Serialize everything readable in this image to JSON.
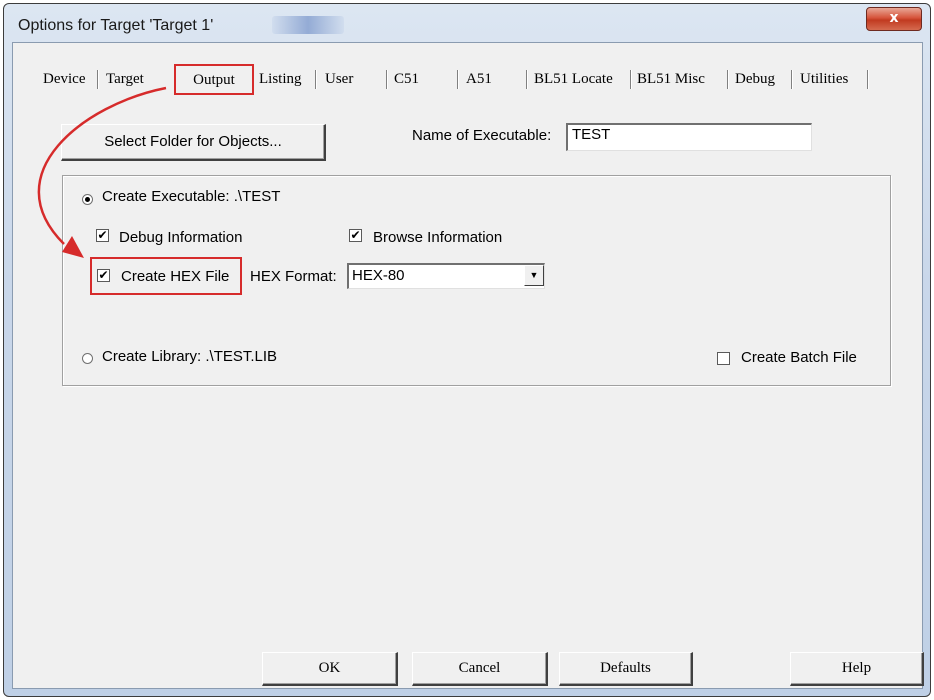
{
  "window": {
    "title": "Options for Target 'Target 1'",
    "close_glyph": "x"
  },
  "tabs": [
    "Device",
    "Target",
    "Output",
    "Listing",
    "User",
    "C51",
    "A51",
    "BL51 Locate",
    "BL51 Misc",
    "Debug",
    "Utilities"
  ],
  "active_tab": "Output",
  "output_page": {
    "select_folder_button": "Select Folder for Objects...",
    "name_of_executable_label": "Name of Executable:",
    "name_of_executable_value": "TEST",
    "create_executable_label": "Create Executable:  .\\TEST",
    "create_executable_selected": true,
    "debug_information_label": "Debug Information",
    "debug_information_checked": true,
    "browse_information_label": "Browse Information",
    "browse_information_checked": true,
    "create_hex_label": "Create HEX File",
    "create_hex_checked": true,
    "hex_format_label": "HEX Format:",
    "hex_format_value": "HEX-80",
    "create_library_label": "Create Library:  .\\TEST.LIB",
    "create_library_selected": false,
    "create_batch_label": "Create Batch File",
    "create_batch_checked": false
  },
  "buttons": {
    "ok": "OK",
    "cancel": "Cancel",
    "defaults": "Defaults",
    "help": "Help"
  },
  "colors": {
    "highlight": "#d62b2b",
    "dialog_bg": "#f0f0f0",
    "titlebar": "#c9d7ea"
  },
  "annotation": {
    "arrow_from": "Output tab",
    "arrow_to": "Create HEX File checkbox"
  }
}
